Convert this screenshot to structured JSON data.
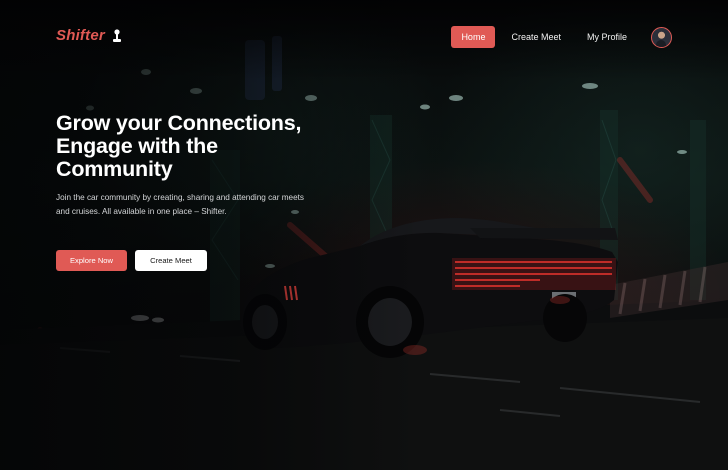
{
  "brand": {
    "name": "Shifter",
    "icon": "gear-shift-icon",
    "color": "#e05a55"
  },
  "nav": {
    "items": [
      {
        "label": "Home",
        "active": true
      },
      {
        "label": "Create Meet",
        "active": false
      },
      {
        "label": "My Profile",
        "active": false
      }
    ],
    "avatar_icon": "user-avatar"
  },
  "hero": {
    "title": "Grow your Connections, Engage with the Community",
    "subtitle": "Join the car community by creating, sharing and attending car meets and cruises. All available in one place – Shifter.",
    "primary_button": "Explore Now",
    "secondary_button": "Create Meet"
  },
  "colors": {
    "accent": "#e05a55",
    "background": "#050607",
    "text": "#ffffff"
  }
}
